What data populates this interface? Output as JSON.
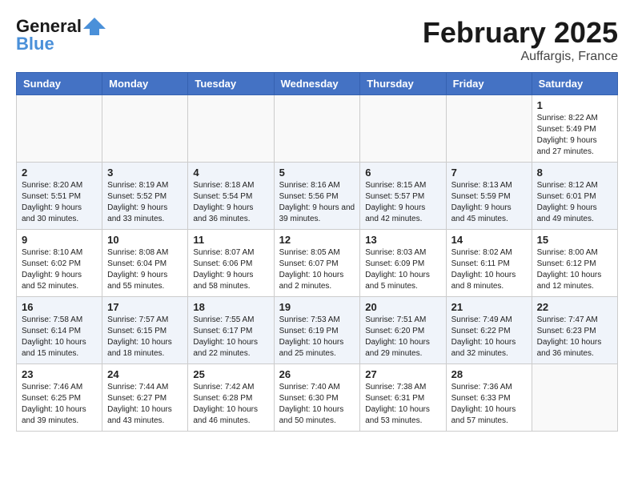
{
  "header": {
    "logo_line1": "General",
    "logo_line2": "Blue",
    "month_title": "February 2025",
    "location": "Auffargis, France"
  },
  "days_of_week": [
    "Sunday",
    "Monday",
    "Tuesday",
    "Wednesday",
    "Thursday",
    "Friday",
    "Saturday"
  ],
  "weeks": [
    [
      {
        "day": "",
        "info": ""
      },
      {
        "day": "",
        "info": ""
      },
      {
        "day": "",
        "info": ""
      },
      {
        "day": "",
        "info": ""
      },
      {
        "day": "",
        "info": ""
      },
      {
        "day": "",
        "info": ""
      },
      {
        "day": "1",
        "info": "Sunrise: 8:22 AM\nSunset: 5:49 PM\nDaylight: 9 hours and 27 minutes."
      }
    ],
    [
      {
        "day": "2",
        "info": "Sunrise: 8:20 AM\nSunset: 5:51 PM\nDaylight: 9 hours and 30 minutes."
      },
      {
        "day": "3",
        "info": "Sunrise: 8:19 AM\nSunset: 5:52 PM\nDaylight: 9 hours and 33 minutes."
      },
      {
        "day": "4",
        "info": "Sunrise: 8:18 AM\nSunset: 5:54 PM\nDaylight: 9 hours and 36 minutes."
      },
      {
        "day": "5",
        "info": "Sunrise: 8:16 AM\nSunset: 5:56 PM\nDaylight: 9 hours and 39 minutes."
      },
      {
        "day": "6",
        "info": "Sunrise: 8:15 AM\nSunset: 5:57 PM\nDaylight: 9 hours and 42 minutes."
      },
      {
        "day": "7",
        "info": "Sunrise: 8:13 AM\nSunset: 5:59 PM\nDaylight: 9 hours and 45 minutes."
      },
      {
        "day": "8",
        "info": "Sunrise: 8:12 AM\nSunset: 6:01 PM\nDaylight: 9 hours and 49 minutes."
      }
    ],
    [
      {
        "day": "9",
        "info": "Sunrise: 8:10 AM\nSunset: 6:02 PM\nDaylight: 9 hours and 52 minutes."
      },
      {
        "day": "10",
        "info": "Sunrise: 8:08 AM\nSunset: 6:04 PM\nDaylight: 9 hours and 55 minutes."
      },
      {
        "day": "11",
        "info": "Sunrise: 8:07 AM\nSunset: 6:06 PM\nDaylight: 9 hours and 58 minutes."
      },
      {
        "day": "12",
        "info": "Sunrise: 8:05 AM\nSunset: 6:07 PM\nDaylight: 10 hours and 2 minutes."
      },
      {
        "day": "13",
        "info": "Sunrise: 8:03 AM\nSunset: 6:09 PM\nDaylight: 10 hours and 5 minutes."
      },
      {
        "day": "14",
        "info": "Sunrise: 8:02 AM\nSunset: 6:11 PM\nDaylight: 10 hours and 8 minutes."
      },
      {
        "day": "15",
        "info": "Sunrise: 8:00 AM\nSunset: 6:12 PM\nDaylight: 10 hours and 12 minutes."
      }
    ],
    [
      {
        "day": "16",
        "info": "Sunrise: 7:58 AM\nSunset: 6:14 PM\nDaylight: 10 hours and 15 minutes."
      },
      {
        "day": "17",
        "info": "Sunrise: 7:57 AM\nSunset: 6:15 PM\nDaylight: 10 hours and 18 minutes."
      },
      {
        "day": "18",
        "info": "Sunrise: 7:55 AM\nSunset: 6:17 PM\nDaylight: 10 hours and 22 minutes."
      },
      {
        "day": "19",
        "info": "Sunrise: 7:53 AM\nSunset: 6:19 PM\nDaylight: 10 hours and 25 minutes."
      },
      {
        "day": "20",
        "info": "Sunrise: 7:51 AM\nSunset: 6:20 PM\nDaylight: 10 hours and 29 minutes."
      },
      {
        "day": "21",
        "info": "Sunrise: 7:49 AM\nSunset: 6:22 PM\nDaylight: 10 hours and 32 minutes."
      },
      {
        "day": "22",
        "info": "Sunrise: 7:47 AM\nSunset: 6:23 PM\nDaylight: 10 hours and 36 minutes."
      }
    ],
    [
      {
        "day": "23",
        "info": "Sunrise: 7:46 AM\nSunset: 6:25 PM\nDaylight: 10 hours and 39 minutes."
      },
      {
        "day": "24",
        "info": "Sunrise: 7:44 AM\nSunset: 6:27 PM\nDaylight: 10 hours and 43 minutes."
      },
      {
        "day": "25",
        "info": "Sunrise: 7:42 AM\nSunset: 6:28 PM\nDaylight: 10 hours and 46 minutes."
      },
      {
        "day": "26",
        "info": "Sunrise: 7:40 AM\nSunset: 6:30 PM\nDaylight: 10 hours and 50 minutes."
      },
      {
        "day": "27",
        "info": "Sunrise: 7:38 AM\nSunset: 6:31 PM\nDaylight: 10 hours and 53 minutes."
      },
      {
        "day": "28",
        "info": "Sunrise: 7:36 AM\nSunset: 6:33 PM\nDaylight: 10 hours and 57 minutes."
      },
      {
        "day": "",
        "info": ""
      }
    ]
  ]
}
